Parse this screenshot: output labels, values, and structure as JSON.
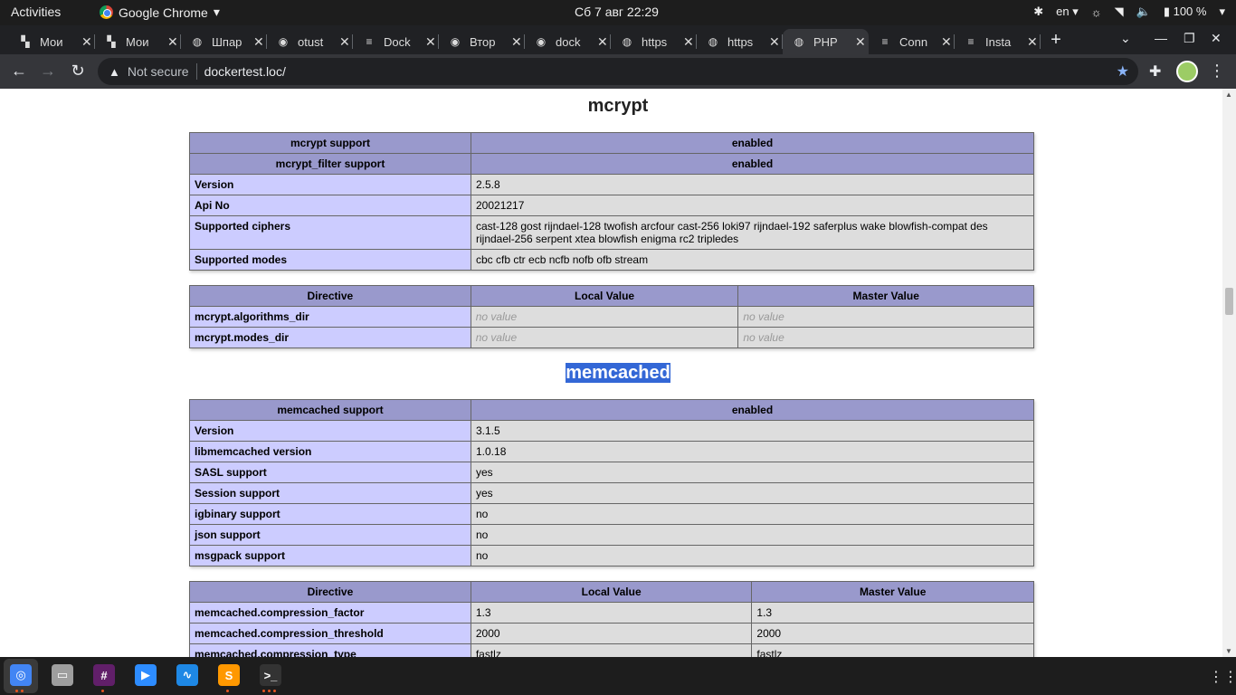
{
  "topbar": {
    "activities": "Activities",
    "app_name": "Google Chrome",
    "clock": "Сб 7 авг  22:29",
    "lang": "en",
    "battery": "100 %"
  },
  "tabs": [
    {
      "title": "Мои",
      "icon": "bookmark-icon"
    },
    {
      "title": "Мои",
      "icon": "bookmark-icon"
    },
    {
      "title": "Шпар",
      "icon": "globe-icon"
    },
    {
      "title": "otust",
      "icon": "github-icon"
    },
    {
      "title": "Dock",
      "icon": "stackoverflow-icon"
    },
    {
      "title": "Втор",
      "icon": "github-icon"
    },
    {
      "title": "dock",
      "icon": "github-icon"
    },
    {
      "title": "https",
      "icon": "globe-icon"
    },
    {
      "title": "https",
      "icon": "globe-icon"
    },
    {
      "title": "PHP",
      "icon": "globe-icon",
      "active": true
    },
    {
      "title": "Conn",
      "icon": "stackoverflow-icon"
    },
    {
      "title": "Insta",
      "icon": "stackoverflow-icon"
    }
  ],
  "toolbar": {
    "not_secure": "Not secure",
    "url": "dockertest.loc/"
  },
  "page": {
    "mcrypt": {
      "heading": "mcrypt",
      "info_rows": [
        {
          "k": "mcrypt support",
          "v": "enabled",
          "header": true
        },
        {
          "k": "mcrypt_filter support",
          "v": "enabled",
          "header": true
        },
        {
          "k": "Version",
          "v": "2.5.8"
        },
        {
          "k": "Api No",
          "v": "20021217"
        },
        {
          "k": "Supported ciphers",
          "v": "cast-128 gost rijndael-128 twofish arcfour cast-256 loki97 rijndael-192 saferplus wake blowfish-compat des rijndael-256 serpent xtea blowfish enigma rc2 tripledes"
        },
        {
          "k": "Supported modes",
          "v": "cbc cfb ctr ecb ncfb nofb ofb stream"
        }
      ],
      "directive_header": [
        "Directive",
        "Local Value",
        "Master Value"
      ],
      "directives": [
        {
          "name": "mcrypt.algorithms_dir",
          "local": "no value",
          "master": "no value"
        },
        {
          "name": "mcrypt.modes_dir",
          "local": "no value",
          "master": "no value"
        }
      ]
    },
    "memcached": {
      "heading": "memcached",
      "info_rows": [
        {
          "k": "memcached support",
          "v": "enabled",
          "header": true
        },
        {
          "k": "Version",
          "v": "3.1.5"
        },
        {
          "k": "libmemcached version",
          "v": "1.0.18"
        },
        {
          "k": "SASL support",
          "v": "yes"
        },
        {
          "k": "Session support",
          "v": "yes"
        },
        {
          "k": "igbinary support",
          "v": "no"
        },
        {
          "k": "json support",
          "v": "no"
        },
        {
          "k": "msgpack support",
          "v": "no"
        }
      ],
      "directive_header": [
        "Directive",
        "Local Value",
        "Master Value"
      ],
      "directives": [
        {
          "name": "memcached.compression_factor",
          "local": "1.3",
          "master": "1.3"
        },
        {
          "name": "memcached.compression_threshold",
          "local": "2000",
          "master": "2000"
        },
        {
          "name": "memcached.compression_type",
          "local": "fastlz",
          "master": "fastlz"
        }
      ]
    }
  },
  "dock": [
    {
      "name": "chrome-icon",
      "color": "#4285f4"
    },
    {
      "name": "files-icon",
      "color": "#9e9e9e"
    },
    {
      "name": "slack-icon",
      "color": "#611f69"
    },
    {
      "name": "zoom-icon",
      "color": "#2d8cff"
    },
    {
      "name": "monitor-icon",
      "color": "#1e88e5"
    },
    {
      "name": "sublime-icon",
      "color": "#ff9800"
    },
    {
      "name": "terminal-icon",
      "color": "#333333"
    }
  ]
}
